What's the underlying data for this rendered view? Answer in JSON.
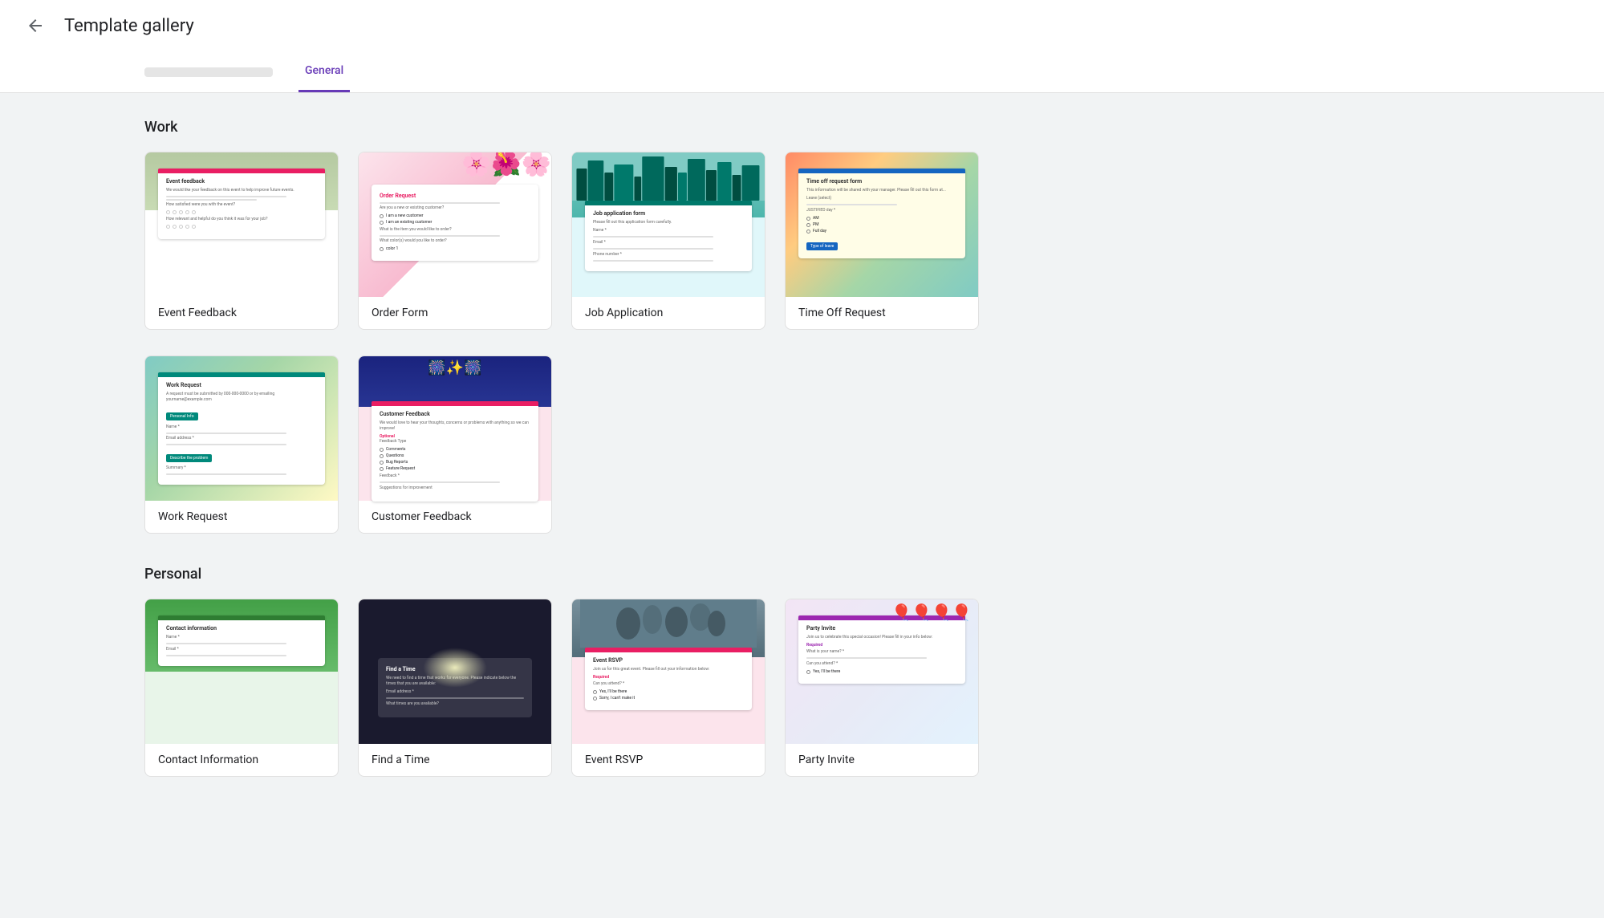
{
  "header": {
    "back_label": "←",
    "title": "Template gallery"
  },
  "tabs": {
    "blurred_tab": "blurred",
    "active_tab": "General"
  },
  "sections": {
    "work": {
      "title": "Work",
      "templates": [
        {
          "id": "event-feedback",
          "label": "Event Feedback",
          "preview_title": "Event feedback",
          "color": "#e91e63"
        },
        {
          "id": "order-form",
          "label": "Order Form",
          "preview_title": "Order Request",
          "color": "#e91e63"
        },
        {
          "id": "job-application",
          "label": "Job Application",
          "preview_title": "Job application form",
          "color": "#00796b"
        },
        {
          "id": "time-off-request",
          "label": "Time Off Request",
          "preview_title": "Time off request form",
          "color": "#1565c0"
        }
      ]
    },
    "work2": {
      "templates": [
        {
          "id": "work-request",
          "label": "Work Request",
          "preview_title": "Work Request",
          "color": "#00897b"
        },
        {
          "id": "customer-feedback",
          "label": "Customer Feedback",
          "preview_title": "Customer Feedback",
          "color": "#e91e63"
        }
      ]
    },
    "personal": {
      "title": "Personal",
      "templates": [
        {
          "id": "contact-information",
          "label": "Contact Information",
          "preview_title": "Contact information",
          "color": "#2e7d32"
        },
        {
          "id": "find-a-time",
          "label": "Find a Time",
          "preview_title": "Find a Time",
          "color": "#fff"
        },
        {
          "id": "event-rsvp",
          "label": "Event RSVP",
          "preview_title": "Event RSVP",
          "color": "#e91e63"
        },
        {
          "id": "party-invite",
          "label": "Party Invite",
          "preview_title": "Party Invite",
          "color": "#9c27b0"
        }
      ]
    }
  },
  "colors": {
    "accent": "#673ab7",
    "tab_active": "#673ab7"
  }
}
